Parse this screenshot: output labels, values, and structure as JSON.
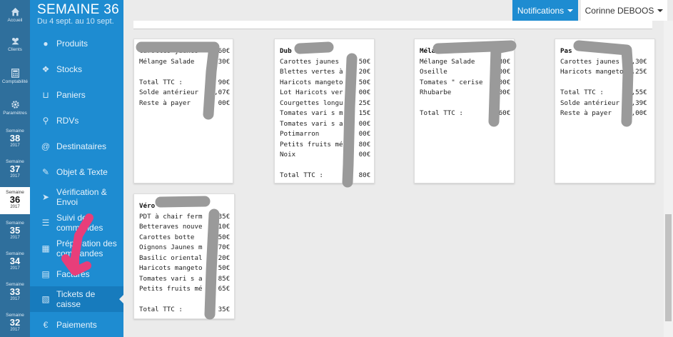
{
  "rail": {
    "home": "Accueil",
    "clients": "Clients",
    "accounting": "Comptabilité",
    "settings": "Paramètres",
    "weeks": [
      {
        "label": "Semaine",
        "num": "38",
        "year": "2017"
      },
      {
        "label": "Semaine",
        "num": "37",
        "year": "2017"
      },
      {
        "label": "Semaine",
        "num": "36",
        "year": "2017"
      },
      {
        "label": "Semaine",
        "num": "35",
        "year": "2017"
      },
      {
        "label": "Semaine",
        "num": "34",
        "year": "2017"
      },
      {
        "label": "Semaine",
        "num": "33",
        "year": "2017"
      },
      {
        "label": "Semaine",
        "num": "32",
        "year": "2017"
      }
    ]
  },
  "menu": {
    "title": "SEMAINE 36",
    "subtitle": "Du 4 sept. au 10 sept.",
    "items": [
      {
        "label": "Produits",
        "icon": "apple-icon"
      },
      {
        "label": "Stocks",
        "icon": "cubes-icon"
      },
      {
        "label": "Paniers",
        "icon": "basket-icon"
      },
      {
        "label": "RDVs",
        "icon": "map-marker-icon"
      },
      {
        "label": "Destinataires",
        "icon": "at-icon"
      },
      {
        "label": "Objet & Texte",
        "icon": "pencil-icon"
      },
      {
        "label": "Vérification & Envoi",
        "icon": "send-icon"
      },
      {
        "label": "Suivi des commandes",
        "icon": "list-icon"
      },
      {
        "label": "Préparation des commandes",
        "icon": "map-icon"
      },
      {
        "label": "Factures",
        "icon": "file-icon"
      },
      {
        "label": "Tickets de caisse",
        "icon": "receipt-icon"
      },
      {
        "label": "Paiements",
        "icon": "euro-icon"
      }
    ]
  },
  "topbar": {
    "notifications": "Notifications",
    "user": "Corinne DEBOOS"
  },
  "tickets": [
    {
      "name": "",
      "lines": "Carottes jaunes     60€\nMélange Salade      30€\n\nTotal TTC :         90€\nSolde antérieur    ,07€\nReste à payer       00€"
    },
    {
      "name": "Dub",
      "lines": "Carottes jaunes     50€\nBlettes vertes à    20€\nHaricots mangeto    50€\nLot Haricots ver    00€\nCourgettes longu    25€\nTomates vari s m    15€\nTomates vari s a    00€\nPotimarron          00€\nPetits fruits mé    80€\nNoix                00€\n\nTotal TTC :         80€"
    },
    {
      "name": "Méla",
      "lines": "Mélange Salade      80€\nOseille             00€\nTomates \" cerise    00€\nRhubarbe            00€\n\nTotal TTC :         60€"
    },
    {
      "name": "Pas",
      "lines": "Carottes jaunes   ,30€\nHaricots mangeto  ,25€\n\nTotal TTC :       ,55€\nSolde antérieur   ,39€\nReste à payer     ,00€"
    },
    {
      "name": "Véro",
      "lines": "PDT à chair ferm    35€\nBetteraves nouve    10€\nCarottes botte      50€\nOignons Jaunes m    70€\nBasilic oriental    20€\nHaricots mangeto    50€\nTomates vari s a    85€\nPetits fruits mé    65€\n\nTotal TTC :         35€"
    }
  ]
}
